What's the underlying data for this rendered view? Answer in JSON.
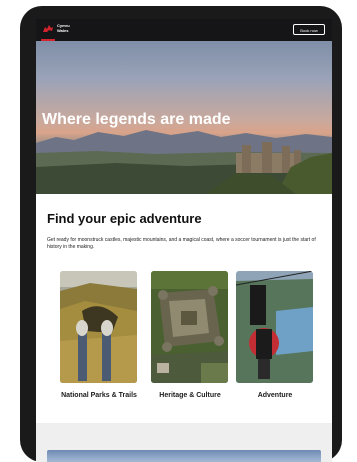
{
  "header": {
    "brand_line1": "Cymru",
    "brand_line2": "Wales",
    "book_label": "Book now"
  },
  "hero": {
    "title": "Where legends are made"
  },
  "section": {
    "heading": "Find your epic adventure",
    "intro": "Get ready for moonstruck castles, majestic mountains, and a magical coast, where a soccer tournament is just the start of history in the making."
  },
  "cards": [
    {
      "label": "National Parks & Trails"
    },
    {
      "label": "Heritage & Culture"
    },
    {
      "label": "Adventure"
    }
  ],
  "colors": {
    "accent": "#d3232e",
    "topbar": "#151517",
    "device": "#1a1a1b"
  }
}
